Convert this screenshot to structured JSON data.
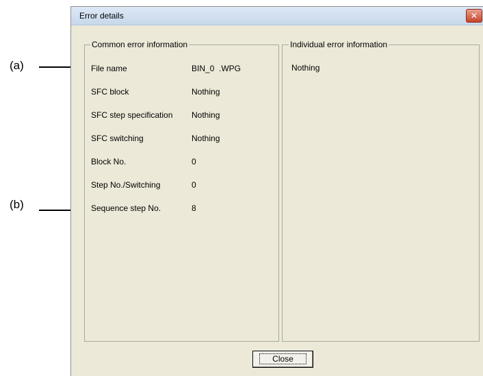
{
  "callouts": {
    "a": "(a)",
    "b": "(b)"
  },
  "dialog": {
    "title": "Error details",
    "close_icon_glyph": "✕",
    "common": {
      "legend": "Common error information",
      "rows": [
        {
          "label": "File name",
          "value": "BIN_0  .WPG"
        },
        {
          "label": "SFC block",
          "value": "Nothing"
        },
        {
          "label": "SFC step specification",
          "value": "Nothing"
        },
        {
          "label": "SFC switching",
          "value": "Nothing"
        },
        {
          "label": "Block No.",
          "value": "0"
        },
        {
          "label": "Step No./Switching",
          "value": "0"
        },
        {
          "label": "Sequence step No.",
          "value": "8"
        }
      ]
    },
    "individual": {
      "legend": "Individual error information",
      "text": "Nothing"
    },
    "close_button": "Close"
  }
}
